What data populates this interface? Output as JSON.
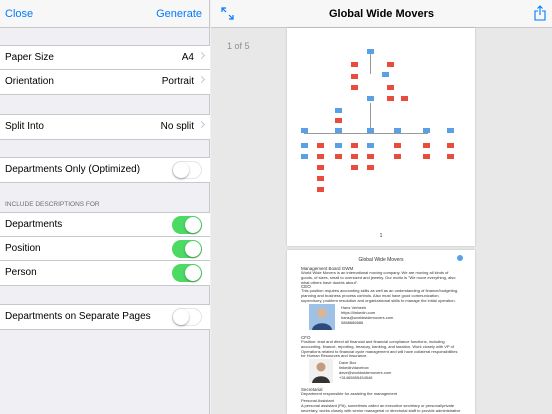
{
  "left": {
    "close": "Close",
    "generate": "Generate",
    "paper_size": {
      "label": "Paper Size",
      "value": "A4"
    },
    "orientation": {
      "label": "Orientation",
      "value": "Portrait"
    },
    "split_into": {
      "label": "Split Into",
      "value": "No split"
    },
    "departments_only": {
      "label": "Departments Only (Optimized)",
      "on": false
    },
    "include_header": "INCLUDE DESCRIPTIONS FOR",
    "departments": {
      "label": "Departments",
      "on": true
    },
    "position": {
      "label": "Position",
      "on": true
    },
    "person": {
      "label": "Person",
      "on": true
    },
    "separate_pages": {
      "label": "Departments on Separate Pages",
      "on": false
    }
  },
  "right": {
    "title": "Global Wide Movers",
    "page_indicator": "1 of 5",
    "page1_number": "1",
    "page2": {
      "title": "Global Wide Movers",
      "board": "Management Board GWM",
      "intro": "World Wide Movers is an international moving company. We are moving all kinds of goods, of sizes, small to oversized and jewelry. Our motto is \"We move everything, also what others have doubts about\".",
      "ceo_title": "CEO",
      "ceo_desc": "This position requires accounting skills as well as an understanding of finance/budgeting, planning and business process controls. Also must have good communication, supervisory, problem resolution and organizational skills to manage the initial operation.",
      "ceo_name": "Hans Verbeek",
      "ceo_web": "https://linkedin.com",
      "ceo_email": "hans@worldwidemovers.com",
      "ceo_phone": "0868686686",
      "cfo_title": "CFO",
      "cfo_desc": "Position: lead and direct all financial and financial compliance functions, including accounting, finance, reporting, treasury, banking, and taxation. Work closely with VP of Operations related to financial cycle management and will have collateral responsibilities for Human Resources and Insurance.",
      "cfo_name": "Dave Box",
      "cfo_web": "linkedin/davebox",
      "cfo_email": "dave@worldwidemovers.com",
      "cfo_phone": "+31465655454546",
      "secretarial_title": "Secretarial",
      "secretarial_desc": "Department responsible for assisting the management",
      "pa_title": "Personal Assistant",
      "pa_desc": "A personal assistant (PA), sometimes called an executive secretary or personal/private secretary, works closely with senior managerial or directorial staff to provide administrative"
    }
  },
  "colors": {
    "accent": "#007aff",
    "toggle_on": "#4cd964",
    "org_blue": "#5aa0e6",
    "org_red": "#e74c3c"
  }
}
